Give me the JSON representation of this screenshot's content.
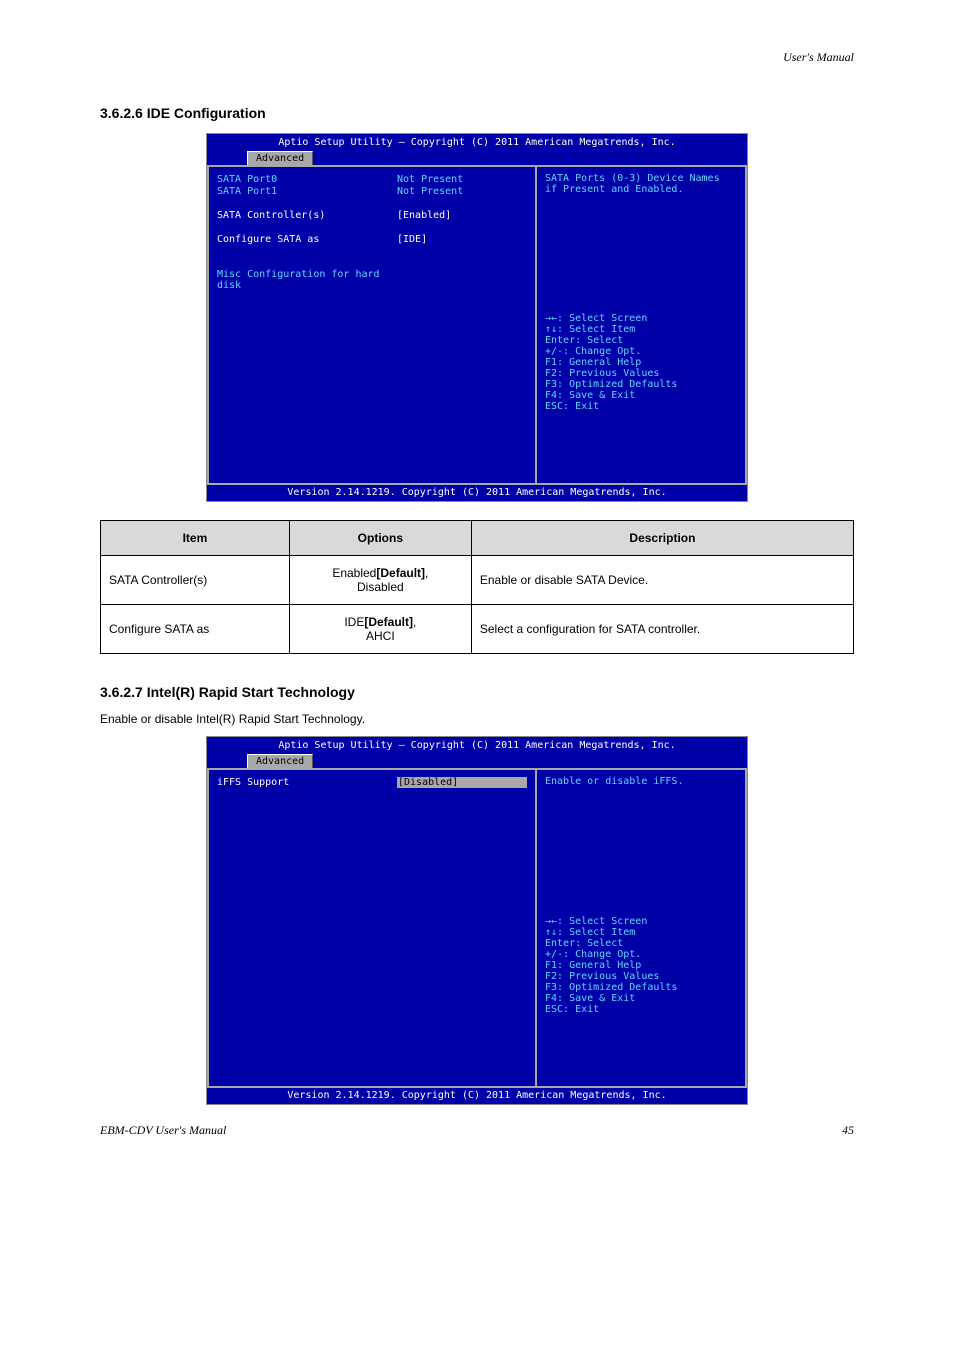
{
  "page_header_right": "User's Manual",
  "page_footer_left": "EBM-CDV User's Manual",
  "page_number": "45",
  "section1_title": "3.6.2.6 IDE Configuration",
  "bios1": {
    "top": "Aptio Setup Utility – Copyright (C) 2011 American Megatrends, Inc.",
    "tab": "Advanced",
    "rows": [
      {
        "label": "SATA Port0",
        "value": "Not Present",
        "lcls": "bios-cyan",
        "vcls": "bios-cyan"
      },
      {
        "label": "SATA Port1",
        "value": "Not Present",
        "lcls": "bios-cyan",
        "vcls": "bios-cyan"
      },
      {
        "spacer": true
      },
      {
        "label": "SATA Controller(s)",
        "value": "[Enabled]",
        "lcls": "bios-white",
        "vcls": "bios-white"
      },
      {
        "spacer": true
      },
      {
        "label": "Configure SATA as",
        "value": "[IDE]",
        "lcls": "bios-white",
        "vcls": "bios-white"
      },
      {
        "spacer": true
      },
      {
        "spacer": true
      },
      {
        "label": "Misc Configuration for hard disk",
        "value": "",
        "lcls": "bios-cyan",
        "vcls": ""
      }
    ],
    "help_top": "SATA Ports (0-3) Device Names if Present and Enabled.",
    "help_bottom": [
      "→←: Select Screen",
      "↑↓: Select Item",
      "Enter: Select",
      "+/-: Change Opt.",
      "F1: General Help",
      "F2: Previous Values",
      "F3: Optimized Defaults",
      "F4: Save & Exit",
      "ESC: Exit"
    ],
    "footer": "Version 2.14.1219. Copyright (C) 2011 American Megatrends, Inc."
  },
  "table": {
    "headers": [
      "Item",
      "Options",
      "Description"
    ],
    "rows": [
      [
        "SATA Controller(s)",
        "Enabled[Default],\nDisabled",
        "Enable or disable SATA Device."
      ],
      [
        "Configure SATA as",
        "IDE[Default],\nAHCI",
        "Select a configuration for SATA controller."
      ]
    ]
  },
  "section2_title": "3.6.2.7 Intel(R) Rapid Start Technology",
  "section2_para": "Enable or disable Intel(R) Rapid Start Technology.",
  "bios2": {
    "top": "Aptio Setup Utility – Copyright (C) 2011 American Megatrends, Inc.",
    "tab": "Advanced",
    "rows": [
      {
        "label": "iFFS Support",
        "value": "[Disabled]",
        "lcls": "bios-white",
        "vcls": "bios-sel"
      }
    ],
    "help_top": "Enable or disable iFFS.",
    "help_bottom": [
      "→←: Select Screen",
      "↑↓: Select Item",
      "Enter: Select",
      "+/-: Change Opt.",
      "F1: General Help",
      "F2: Previous Values",
      "F3: Optimized Defaults",
      "F4: Save & Exit",
      "ESC: Exit"
    ],
    "footer": "Version 2.14.1219. Copyright (C) 2011 American Megatrends, Inc."
  }
}
